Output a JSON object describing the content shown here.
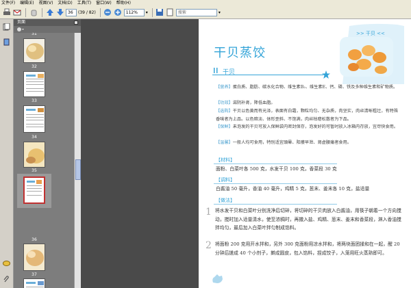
{
  "menu": [
    "文件(F)",
    "编辑(E)",
    "视图(V)",
    "文档(D)",
    "工具(T)",
    "窗口(W)",
    "帮助(H)"
  ],
  "toolbar": {
    "page_current": "36",
    "page_total": "(39 / 82)",
    "zoom": "112%",
    "search_placeholder": "搜索"
  },
  "panel": {
    "title": "页面",
    "thumbnails": [
      {
        "num": "31"
      },
      {
        "num": "32"
      },
      {
        "num": "33"
      },
      {
        "num": "34"
      },
      {
        "num": "35"
      },
      {
        "num": "36"
      },
      {
        "num": "37"
      }
    ]
  },
  "page": {
    "tag": ">> 干贝 <<",
    "title": "干贝蒸饺",
    "subtitle": "干贝",
    "nutrition_label": "【营养】",
    "nutrition": "蛋白质、脂肪、碳水化合物、维生素B₂、维生素E、钙、磷、铁及多种维生素和矿物质。",
    "function_label": "【功效】",
    "function": "滋阴补肾，降低血脂。",
    "select_label": "【选购】",
    "select": "干贝以色黄而有光泽，表面有白霜，颗粒均匀、无杂质，肉坚实，肉丝清晰粗壮，有特殊香味者为上品。以色暗淡、体形歪斜、不饱满，肉丝枯瘪松散者为下品。",
    "keep_label": "【保鲜】",
    "keep": "未泡发的干贝可放入保鲜袋内密封保存，泡发好的可暂时放入冰箱内存放，宜尽快食用。",
    "note_label": "【温馨】",
    "note": "一般人均可食用，特别适宜頭晕、阳痿早泄、肾虚腰痛者食用。",
    "materials_head": "【材料】",
    "materials": "面粉、白菜叶各 500 克，水发干贝 100 克，香菜段 30 克",
    "seasoning_head": "【调料】",
    "seasoning": "白酱油 50 毫升，香油 40 毫升，鸡精 5 克，葱末、姜末各 10 克，盐适量",
    "method_head": "【做法】",
    "steps": [
      {
        "n": "1",
        "text": "将水发干贝和白菜叶分别洗净后切碎，将切碎的干贝肉放入白酱油，用筷子朝着一个方向搅动，搅时加入适量清水，使至浓稠时，再撒入盐、鸡精、葱末、姜末和香菜段，淋入香油搅拌均匀，最后加入白菜叶拌匀制成馅料。"
      },
      {
        "n": "2",
        "text": "将面粉 200 克用开水拌和，另外 300 克面粉用凉水拌和，将两块面团揉和在一起，醒 20 分钟后搓成 40 个小剂子，擀成圆皮，包入馅料，捏成饺子，入笼用旺火蒸熟即可。"
      }
    ]
  },
  "colors": {
    "accent": "#34a4d8",
    "panel": "#7d7d7d",
    "doc_bg": "#4a4a4a"
  },
  "icons": [
    "print-icon",
    "email-icon",
    "hand-icon",
    "up-arrow-icon",
    "down-arrow-icon",
    "zoom-out-icon",
    "zoom-in-icon",
    "save-icon",
    "fit-page-icon",
    "pages-icon",
    "bookmark-icon",
    "comment-icon",
    "attachment-icon"
  ]
}
